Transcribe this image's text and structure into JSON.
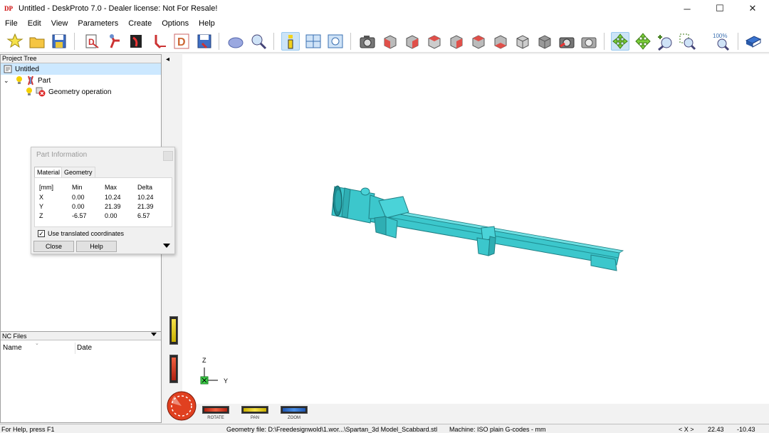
{
  "window": {
    "title": "Untitled - DeskProto 7.0 - Dealer license: Not For Resale!",
    "logo_text": "DP",
    "minimize": "─",
    "maximize": "☐",
    "close": "✕"
  },
  "menu": [
    "File",
    "Edit",
    "View",
    "Parameters",
    "Create",
    "Options",
    "Help"
  ],
  "toolbar": {
    "zoom_level": "100%",
    "icons": [
      "new-project-icon",
      "open-icon",
      "save-icon",
      "part-wizard-icon",
      "part-wizard-2-icon",
      "three-axis-wizard-icon",
      "vector-wizard-icon",
      "drawing-wizard-icon",
      "nc-file-icon",
      "object-icon",
      "zoom-part-icon",
      "info-icon",
      "view-layout-icon",
      "preview-icon",
      "camera-icon",
      "view-front-icon",
      "view-back-icon",
      "view-left-icon",
      "view-right-icon",
      "view-top-icon",
      "view-bottom-icon",
      "view-iso-icon",
      "view-iso-2-icon",
      "camera-save-icon",
      "camera-restore-icon",
      "rotate-icon",
      "pan-icon",
      "zoom-in-icon",
      "zoom-window-icon",
      "zoom-100-icon",
      "book-icon"
    ]
  },
  "project_tree": {
    "header": "Project Tree",
    "root": "Untitled",
    "part": "Part",
    "operation": "Geometry operation"
  },
  "part_info": {
    "title": "Part Information",
    "tabs": [
      "Material",
      "Geometry"
    ],
    "columns": [
      "[mm]",
      "Min",
      "Max",
      "Delta"
    ],
    "rows": [
      {
        "axis": "X",
        "min": "0.00",
        "max": "10.24",
        "delta": "10.24"
      },
      {
        "axis": "Y",
        "min": "0.00",
        "max": "21.39",
        "delta": "21.39"
      },
      {
        "axis": "Z",
        "min": "-6.57",
        "max": "0.00",
        "delta": "6.57"
      }
    ],
    "checkbox_label": "Use translated coordinates",
    "checkbox_checked": "✓",
    "close_button": "Close",
    "help_button": "Help"
  },
  "nc_files": {
    "header": "NC Files",
    "col_name": "Name",
    "col_date": "Date"
  },
  "viewport": {
    "axis_z": "Z",
    "axis_y": "Y",
    "left_arrow": "◂",
    "model_color": "#3cc7cc",
    "controls": {
      "rotate": "ROTATE",
      "pan": "PAN",
      "zoom": "ZOOM"
    }
  },
  "statusbar": {
    "help": "For Help, press F1",
    "geometry": "Geometry file: D:\\Freedesignwold\\1.wor...\\Spartan_3d Model_Scabbard.stl",
    "machine": "Machine: ISO plain G-codes - mm",
    "xy_label": "< X >",
    "x_value": "22.43",
    "y_value": "-10.43"
  }
}
